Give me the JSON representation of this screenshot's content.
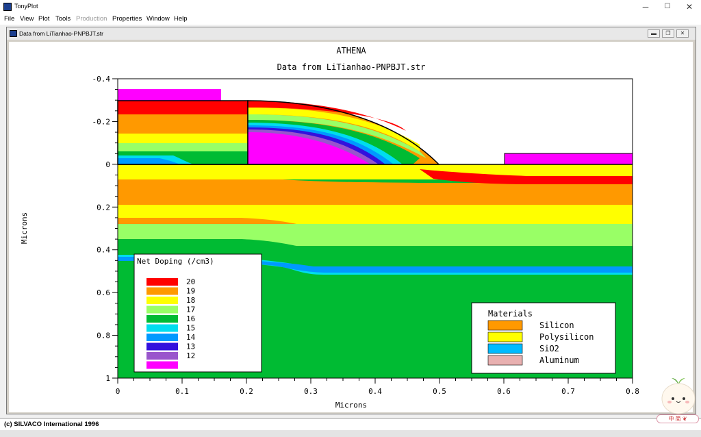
{
  "window": {
    "title": "TonyPlot",
    "controls": {
      "minimize": "─",
      "maximize": "☐",
      "close": "✕"
    }
  },
  "menu": [
    {
      "label": "File",
      "enabled": true
    },
    {
      "label": "View",
      "enabled": true
    },
    {
      "label": "Plot",
      "enabled": true
    },
    {
      "label": "Tools",
      "enabled": true
    },
    {
      "label": "Production",
      "enabled": false
    },
    {
      "label": "Properties",
      "enabled": true
    },
    {
      "label": "Window",
      "enabled": true
    },
    {
      "label": "Help",
      "enabled": true
    }
  ],
  "subwindow": {
    "title": "Data from LiTianhao-PNPBJT.str"
  },
  "plot": {
    "title": "ATHENA",
    "subtitle": "Data from LiTianhao-PNPBJT.str",
    "xlabel": "Microns",
    "ylabel": "Microns",
    "x_ticks": [
      "0",
      "0.1",
      "0.2",
      "0.3",
      "0.4",
      "0.5",
      "0.6",
      "0.7",
      "0.8"
    ],
    "y_ticks": [
      "-0.4",
      "-0.2",
      "0",
      "0.2",
      "0.4",
      "0.6",
      "0.8",
      "1"
    ]
  },
  "doping_legend": {
    "title": "Net Doping (/cm3)",
    "items": [
      {
        "label": "20",
        "color": "#ff0000"
      },
      {
        "label": "19",
        "color": "#ff9900"
      },
      {
        "label": "18",
        "color": "#ffff00"
      },
      {
        "label": "17",
        "color": "#99ff66"
      },
      {
        "label": "16",
        "color": "#00bb33"
      },
      {
        "label": "15",
        "color": "#00ddee"
      },
      {
        "label": "14",
        "color": "#0099ff"
      },
      {
        "label": "13",
        "color": "#3311dd"
      },
      {
        "label": "12",
        "color": "#9955cc"
      },
      {
        "label": "",
        "color": "#ff00ff"
      }
    ]
  },
  "materials_legend": {
    "title": "Materials",
    "items": [
      {
        "label": "Silicon",
        "color": "#ff9900"
      },
      {
        "label": "Polysilicon",
        "color": "#ffff00"
      },
      {
        "label": "SiO2",
        "color": "#00bbff"
      },
      {
        "label": "Aluminum",
        "color": "#e8b0b0"
      }
    ]
  },
  "status": {
    "text": "(c) SILVACO International 1996"
  },
  "tray": {
    "ime": "中 简 ❦"
  }
}
